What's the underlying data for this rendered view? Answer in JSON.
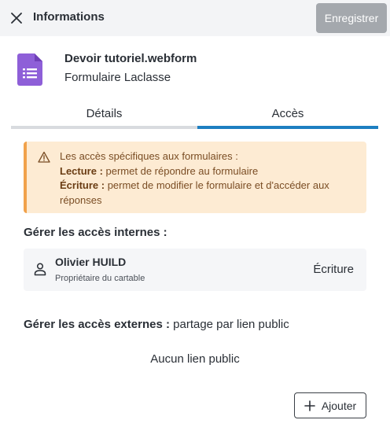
{
  "header": {
    "title": "Informations",
    "save_label": "Enregistrer"
  },
  "document": {
    "name": "Devoir tutoriel.webform",
    "type": "Formulaire Laclasse",
    "icon": "form-document-icon",
    "icon_color": "#8e5fd8"
  },
  "tabs": [
    {
      "label": "Détails",
      "active": false
    },
    {
      "label": "Accès",
      "active": true
    }
  ],
  "warning": {
    "intro": "Les accès spécifiques aux formulaires :",
    "read_label": "Lecture :",
    "read_text": " permet de répondre au formulaire",
    "write_label": "Écriture :",
    "write_text": " permet de modifier le formulaire et d'accéder aux réponses"
  },
  "internal": {
    "title": "Gérer les accès internes :",
    "user": {
      "name": "Olivier HUILD",
      "role": "Propriétaire du cartable",
      "access": "Écriture"
    }
  },
  "external": {
    "title": "Gérer les accès externes :",
    "subtitle": " partage par lien public",
    "empty_text": "Aucun lien public",
    "add_label": "Ajouter"
  },
  "colors": {
    "accent": "#1d7fc1",
    "warning_bg": "#fdebd3",
    "warning_border": "#f1a24b"
  }
}
